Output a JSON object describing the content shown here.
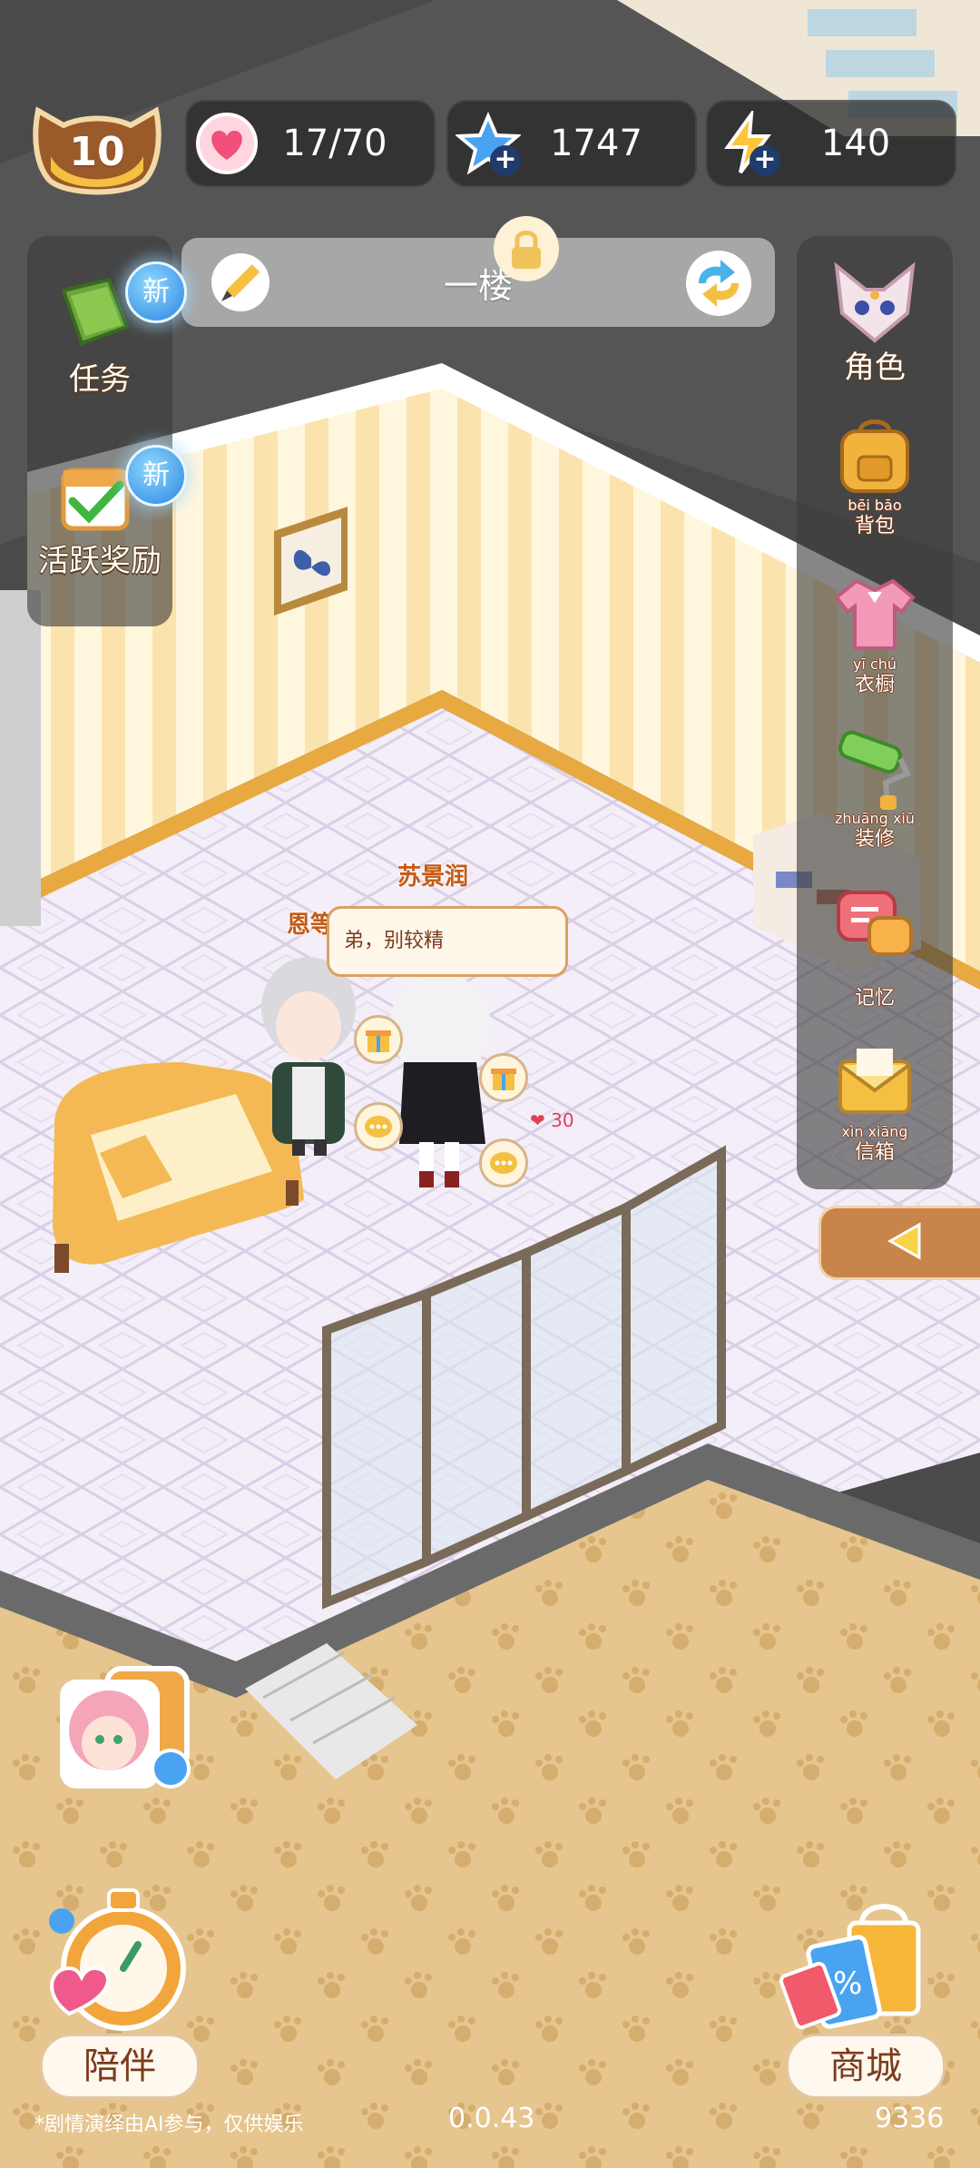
{
  "level": "10",
  "resources": {
    "hearts": "17/70",
    "stars": "1747",
    "energy": "140"
  },
  "floor_selector": {
    "label": "一楼"
  },
  "left_menu": [
    {
      "label": "任务",
      "badge": "新",
      "icon": "task-book-icon"
    },
    {
      "label": "活跃奖励",
      "badge": "新",
      "icon": "calendar-check-icon"
    }
  ],
  "right_menu": [
    {
      "label": "角色",
      "icon": "fox-character-icon"
    },
    {
      "label": "背包",
      "pinyin": "bēi bāo",
      "icon": "backpack-icon"
    },
    {
      "label": "衣橱",
      "pinyin": "yī chú",
      "icon": "wardrobe-shirt-icon"
    },
    {
      "label": "装修",
      "pinyin": "zhuāng xiū",
      "icon": "paint-roller-icon"
    },
    {
      "label": "记忆",
      "icon": "memory-chat-icon"
    },
    {
      "label": "信箱",
      "pinyin": "xìn xiāng",
      "icon": "mail-envelope-icon"
    }
  ],
  "scene": {
    "npc_name_top": "苏景润",
    "npc_name_left": "恩等",
    "speech_text": "弟，别较精",
    "affection_value": "30"
  },
  "bottom": {
    "companion_label": "陪伴",
    "shop_label": "商城",
    "disclaimer": "*剧情演绎由AI参与，仅供娱乐",
    "version": "0.0.43",
    "user_id": "9336"
  },
  "colors": {
    "wall_stripe_a": "#fbe7b8",
    "wall_stripe_b": "#fff6de",
    "floor_tile": "#efe8f5",
    "carpet": "#e3c287",
    "panel_bg": "#3c3c3c",
    "accent_orange": "#e59a3c"
  }
}
